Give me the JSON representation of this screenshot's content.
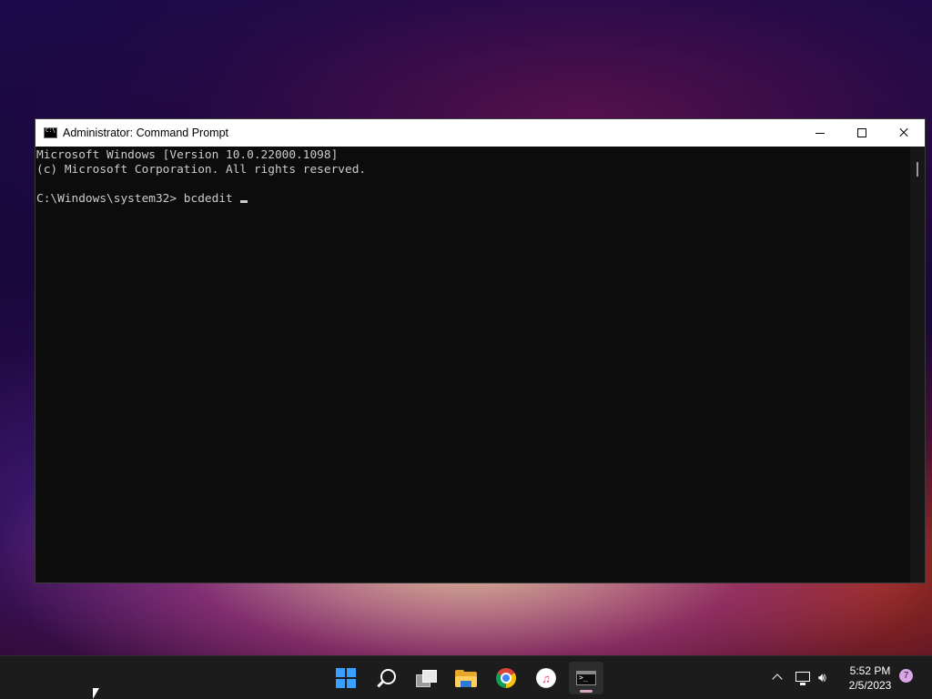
{
  "window": {
    "title": "Administrator: Command Prompt",
    "console_lines": [
      "Microsoft Windows [Version 10.0.22000.1098]",
      "(c) Microsoft Corporation. All rights reserved.",
      "",
      "C:\\Windows\\system32> bcdedit "
    ]
  },
  "taskbar": {
    "pinned": [
      {
        "name": "start-button",
        "icon": "windows-start-icon"
      },
      {
        "name": "search-button",
        "icon": "search-icon"
      },
      {
        "name": "task-view-button",
        "icon": "task-view-icon"
      },
      {
        "name": "file-explorer-button",
        "icon": "folder-icon"
      },
      {
        "name": "chrome-button",
        "icon": "chrome-icon"
      },
      {
        "name": "itunes-button",
        "icon": "itunes-icon"
      },
      {
        "name": "command-prompt-button",
        "icon": "cmd-icon",
        "active": true
      }
    ],
    "clock": {
      "time": "5:52 PM",
      "date": "2/5/2023"
    },
    "notification_count": "7"
  },
  "colors": {
    "console_bg": "#0c0c0c",
    "console_text": "#cccccc",
    "taskbar_bg": "#1c1c1c",
    "start_blue": "#3aa0ff"
  }
}
